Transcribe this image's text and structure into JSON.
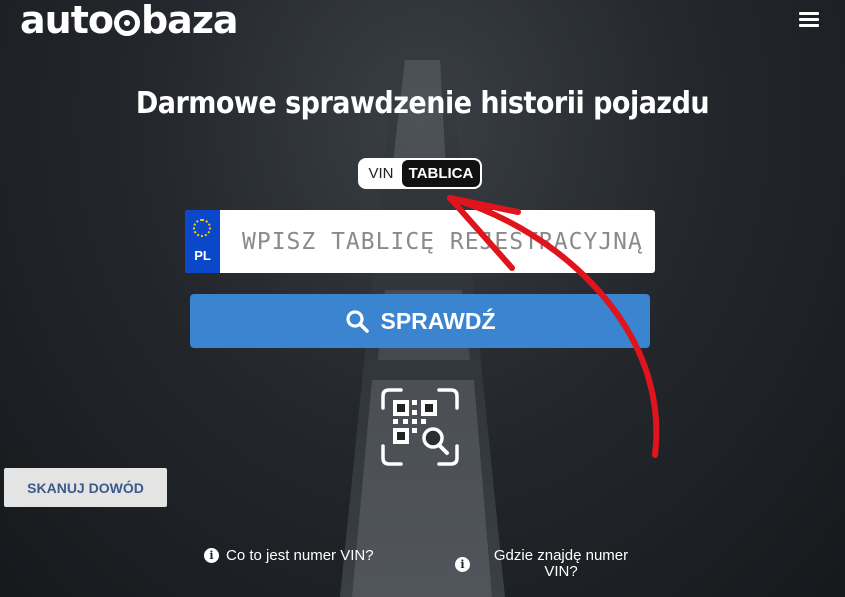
{
  "header": {
    "logo_text_a": "auto",
    "logo_text_b": "baza",
    "menu_icon": "hamburger-icon"
  },
  "hero": {
    "title": "Darmowe sprawdzenie historii pojazdu"
  },
  "mode_toggle": {
    "vin_label": "VIN",
    "plate_label": "TABLICA",
    "selected": "TABLICA"
  },
  "plate_input": {
    "country_code": "PL",
    "placeholder": "WPISZ TABLICĘ REJESTRACYJNĄ",
    "value": ""
  },
  "search_button": {
    "label": "SPRAWDŹ",
    "icon": "search-icon"
  },
  "qr_scanner": {
    "icon": "qr-scan-icon"
  },
  "scan_document_button": {
    "label": "SKANUJ DOWÓD"
  },
  "help_links": [
    {
      "label": "Co to jest numer VIN?",
      "icon": "info-icon"
    },
    {
      "label": "Gdzie znajdę numer VIN?",
      "icon": "info-icon"
    }
  ],
  "colors": {
    "primary_button": "#3a84d0",
    "eu_band": "#0a47c9",
    "annotation_arrow": "#e0141c",
    "scan_button_text": "#3b5a8a"
  }
}
